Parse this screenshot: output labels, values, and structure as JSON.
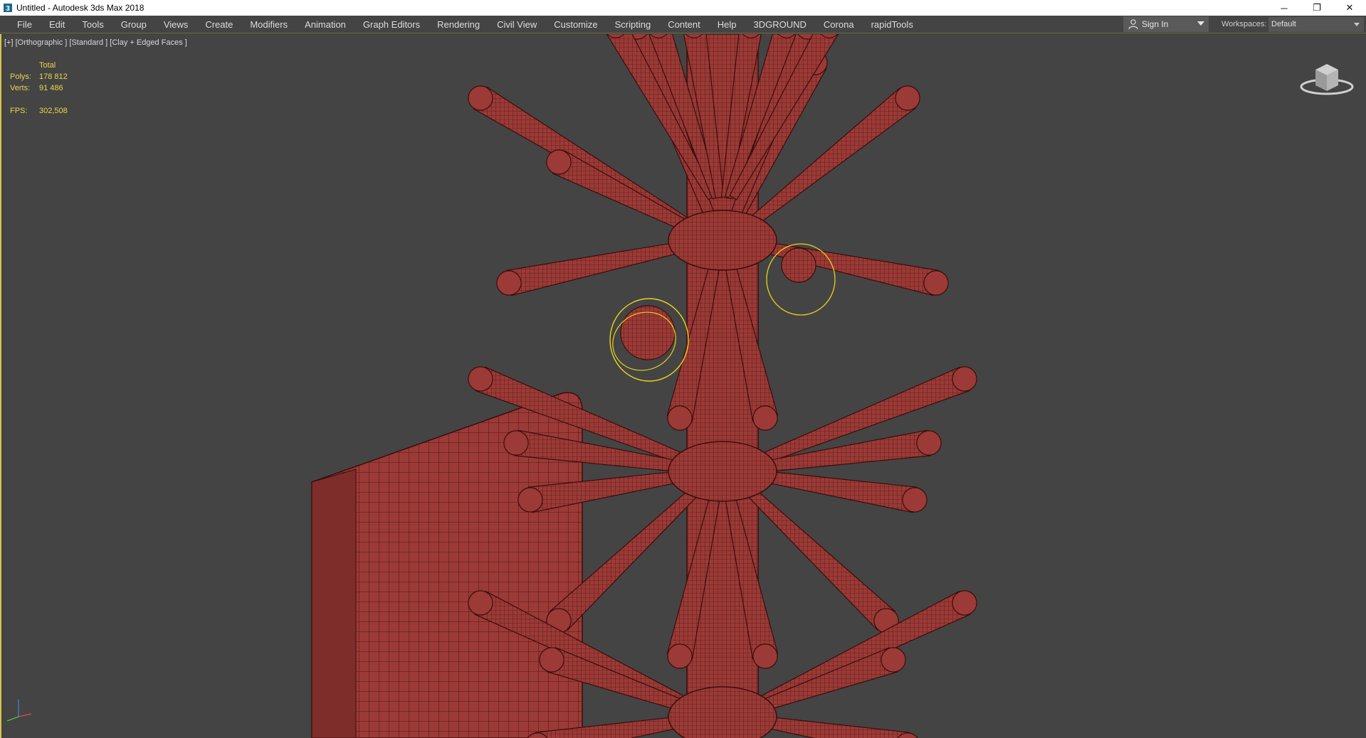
{
  "window": {
    "title": "Untitled - Autodesk 3ds Max 2018",
    "minimize_glyph": "─",
    "restore_glyph": "❐",
    "close_glyph": "✕"
  },
  "menu": {
    "items": [
      "File",
      "Edit",
      "Tools",
      "Group",
      "Views",
      "Create",
      "Modifiers",
      "Animation",
      "Graph Editors",
      "Rendering",
      "Civil View",
      "Customize",
      "Scripting",
      "Content",
      "Help",
      "3DGROUND",
      "Corona",
      "rapidTools"
    ],
    "sign_in": "Sign In",
    "workspaces_label": "Workspaces:",
    "workspace_value": "Default"
  },
  "viewport": {
    "label": "[+] [Orthographic ] [Standard ] [Clay + Edged Faces ]",
    "stats": {
      "header": "Total",
      "polys_label": "Polys:",
      "polys_value": "178 812",
      "verts_label": "Verts:",
      "verts_value": "91 486",
      "fps_label": "FPS:",
      "fps_value": "302,508"
    }
  },
  "colors": {
    "viewport_bg": "#444444",
    "mesh_fill": "#9b3a36",
    "mesh_wire": "#3a0d0c",
    "stats_text": "#e8d64a",
    "selection_gizmo": "#e8d21a"
  },
  "icons": [
    "app-icon",
    "user-icon",
    "viewcube-icon",
    "axis-tripod-icon"
  ]
}
